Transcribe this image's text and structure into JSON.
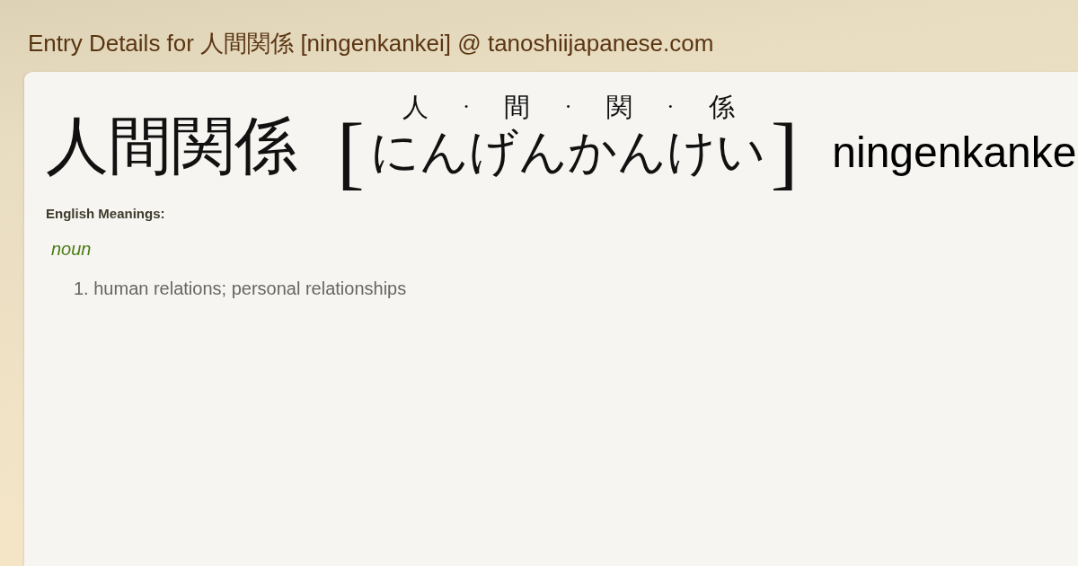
{
  "page_title": "Entry Details for 人間関係 [ningenkankei] @ tanoshiijapanese.com",
  "entry": {
    "headword": "人間関係",
    "open_bracket": "[",
    "furigana": [
      {
        "kind": "kanji",
        "text": "人"
      },
      {
        "kind": "separator",
        "text": "·"
      },
      {
        "kind": "kanji",
        "text": "間"
      },
      {
        "kind": "separator",
        "text": "·"
      },
      {
        "kind": "kanji",
        "text": "関"
      },
      {
        "kind": "separator",
        "text": "·"
      },
      {
        "kind": "kanji",
        "text": "係"
      }
    ],
    "reading": "にんげんかんけい",
    "close_bracket": "]",
    "romaji": "ningenkanke"
  },
  "meanings_heading": "English Meanings:",
  "senses": [
    {
      "part_of_speech": "noun",
      "meanings": [
        {
          "number": "1.",
          "text": "human relations; personal relationships"
        }
      ]
    }
  ]
}
